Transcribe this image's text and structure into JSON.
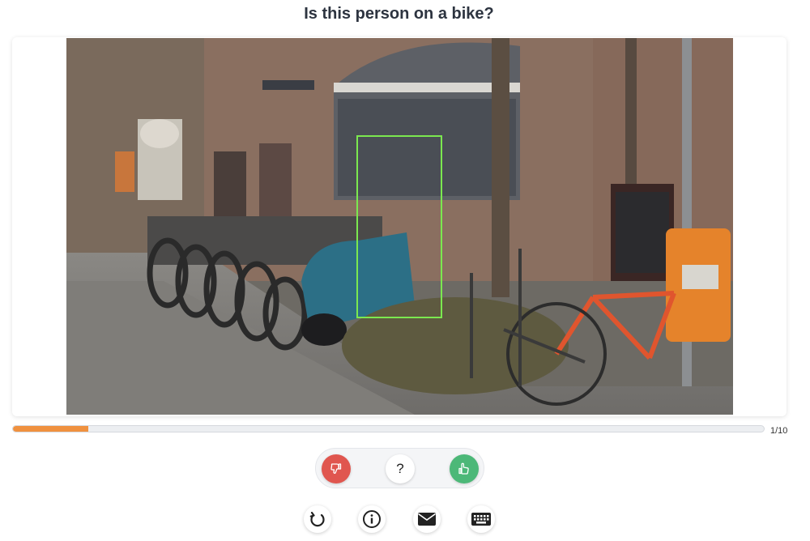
{
  "question": "Is this person on a bike?",
  "image": {
    "description_icon": "street-scene-photo",
    "bbox_color": "#7be84f"
  },
  "progress": {
    "current": 1,
    "total": 10,
    "fraction": 0.1,
    "label": "1/10",
    "fill_color": "#f0913f"
  },
  "answers": {
    "no": {
      "icon": "thumbs-down-icon",
      "color": "#e0564f"
    },
    "unsure": {
      "label": "?",
      "color": "#ffffff"
    },
    "yes": {
      "icon": "thumbs-up-icon",
      "color": "#4cb878"
    }
  },
  "toolbar": {
    "items": [
      {
        "icon": "undo-icon"
      },
      {
        "icon": "info-icon"
      },
      {
        "icon": "mail-icon"
      },
      {
        "icon": "keyboard-icon"
      }
    ]
  }
}
